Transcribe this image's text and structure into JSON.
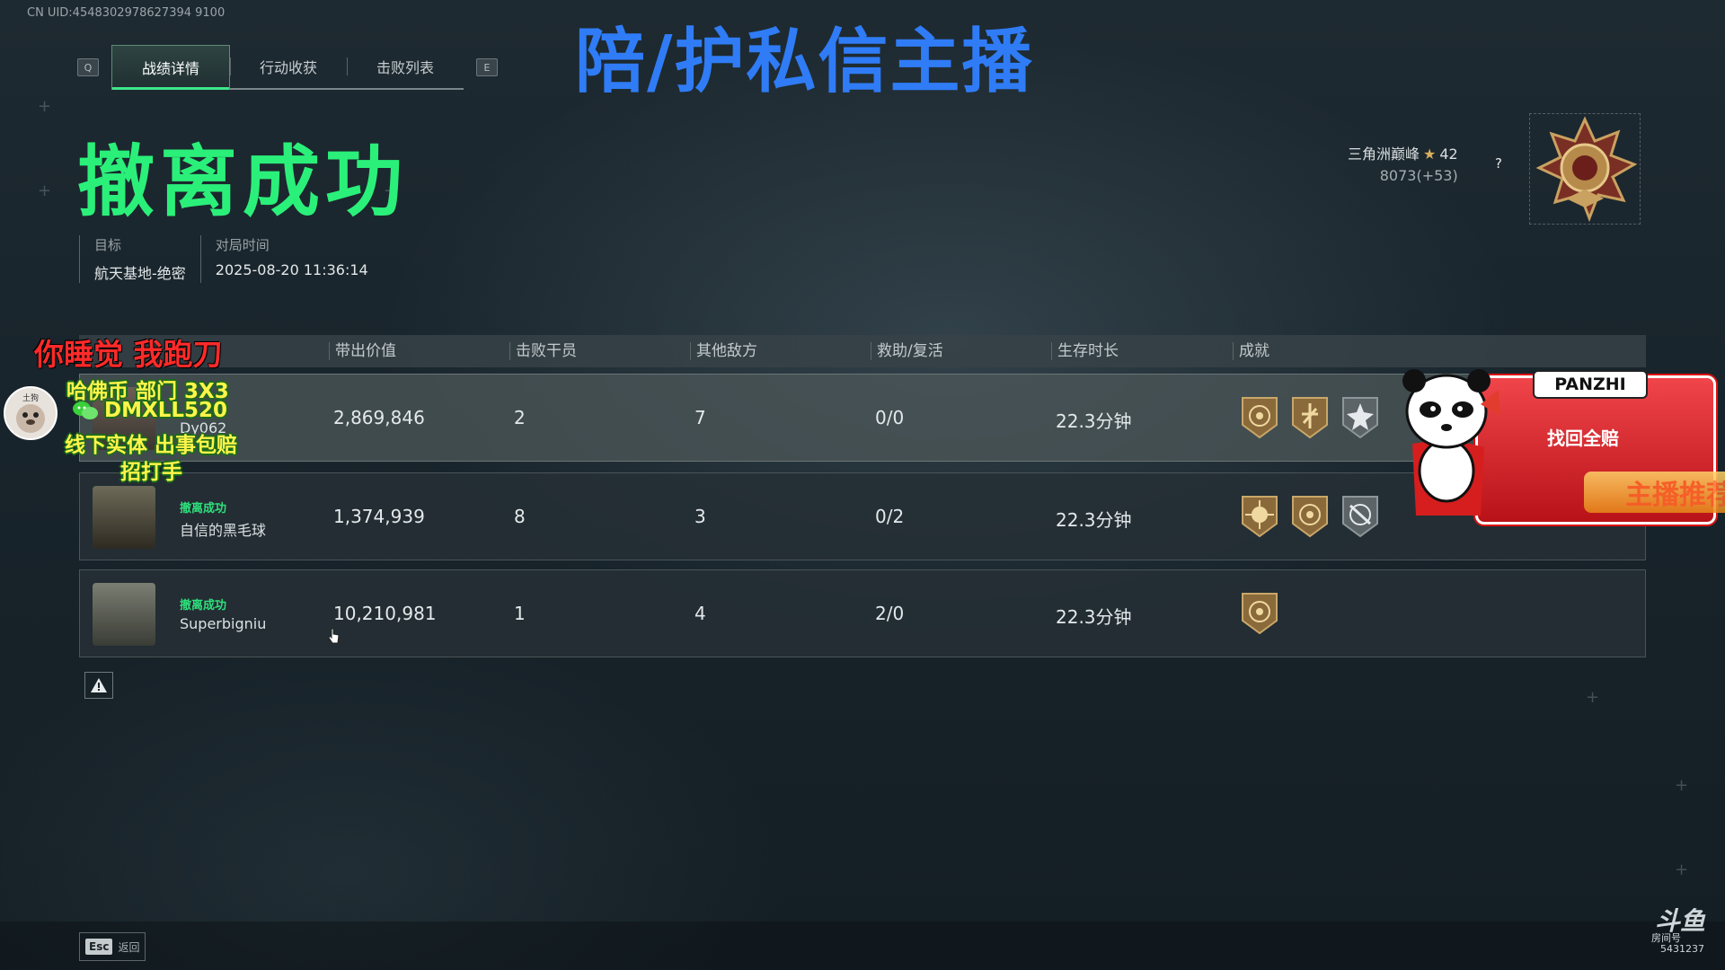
{
  "uid": "CN UID:4548302978627394 9100",
  "tabs": {
    "left_key": "Q",
    "right_key": "E",
    "items": [
      {
        "label": "战绩详情",
        "active": true
      },
      {
        "label": "行动收获",
        "active": false
      },
      {
        "label": "击败列表",
        "active": false
      }
    ]
  },
  "overlay_title": "陪/护私信主播",
  "result_title": "撤离成功",
  "match_info": {
    "target_label": "目标",
    "target_value": "航天基地-绝密",
    "time_label": "对局时间",
    "time_value": "2025-08-20 11:36:14"
  },
  "rank": {
    "name": "三角洲巅峰",
    "stars": "42",
    "points": "8073(+53)",
    "help": "?"
  },
  "table": {
    "headers": [
      "带出价值",
      "击败干员",
      "其他敌方",
      "救助/复活",
      "生存时长",
      "成就"
    ],
    "rows": [
      {
        "status": "",
        "name": "Dy062",
        "value": "2,869,846",
        "kills": "2",
        "other": "7",
        "assist": "0/0",
        "survival": "22.3分钟",
        "medals": 5
      },
      {
        "status": "撤离成功",
        "name": "自信的黑毛球",
        "value": "1,374,939",
        "kills": "8",
        "other": "3",
        "assist": "0/2",
        "survival": "22.3分钟",
        "medals": 5
      },
      {
        "status": "撤离成功",
        "name": "Superbigniu",
        "value": "10,210,981",
        "kills": "1",
        "other": "4",
        "assist": "2/0",
        "survival": "22.3分钟",
        "medals": 1
      }
    ]
  },
  "footer": {
    "esc_key": "Esc",
    "esc_label": "返回"
  },
  "stream_overlay": {
    "red_text": "你睡觉 我跑刀",
    "line1": "哈佛币 部门 3X3",
    "line2": "DMXLL520",
    "line3": "线下实体 出事包赔",
    "line4": "招打手",
    "avatar_label": "土狗",
    "panzhi_label": "PANZHI",
    "panzhi_text1": "找回全赔",
    "panzhi_text2": "主播推荐"
  },
  "watermark": {
    "brand": "斗鱼",
    "sub": "房间号",
    "room": "5431237"
  },
  "colors": {
    "success_green": "#2af07a",
    "overlay_blue": "#2f7cf6",
    "overlay_red": "#ff2a2a",
    "overlay_yellow": "#fff44a"
  }
}
